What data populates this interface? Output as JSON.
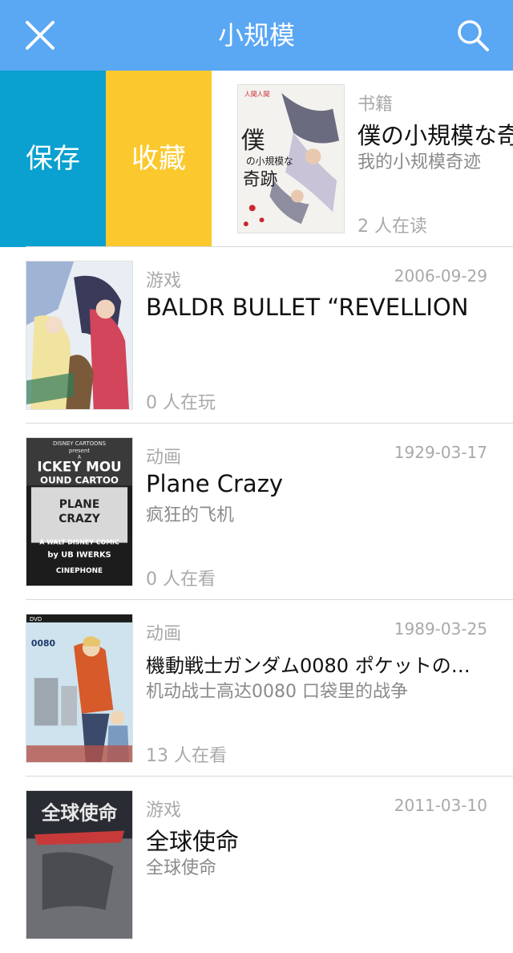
{
  "navbar": {
    "title": "小规模",
    "close_icon": "close-icon",
    "search_icon": "search-icon",
    "background": "#5aa7f3"
  },
  "swipe_actions": {
    "save_label": "保存",
    "save_color": "#0aa0cf",
    "favorite_label": "收藏",
    "favorite_color": "#fbc92e"
  },
  "items": [
    {
      "category": "书籍",
      "date": "",
      "title": "僕の小規模な奇",
      "subtitle": "我的小规模奇迹",
      "count": "2 人在读",
      "cover_text": "僕の小規模な奇跡"
    },
    {
      "category": "游戏",
      "date": "2006-09-29",
      "title": "BALDR BULLET “REVELLION",
      "subtitle": "",
      "count": "0 人在玩"
    },
    {
      "category": "动画",
      "date": "1929-03-17",
      "title": "Plane Crazy",
      "subtitle": "疯狂的飞机",
      "count": "0 人在看",
      "cover_text_lines": [
        "DISNEY CARTOONS",
        "present",
        "A",
        "ICKEY MOU",
        "OUND CARTOO",
        "PLANE",
        "CRAZY",
        "A WALT DISNEY COMIC",
        "by UB IWERKS",
        "CINEPHONE"
      ]
    },
    {
      "category": "动画",
      "date": "1989-03-25",
      "title": "機動戦士ガンダム0080 ポケットの…",
      "subtitle": "机动战士高达0080 口袋里的战争",
      "count": "13 人在看",
      "cover_text": "0080"
    },
    {
      "category": "游戏",
      "date": "2011-03-10",
      "title": "全球使命",
      "subtitle": "全球使命",
      "count": "",
      "cover_text": "全球使命"
    }
  ]
}
